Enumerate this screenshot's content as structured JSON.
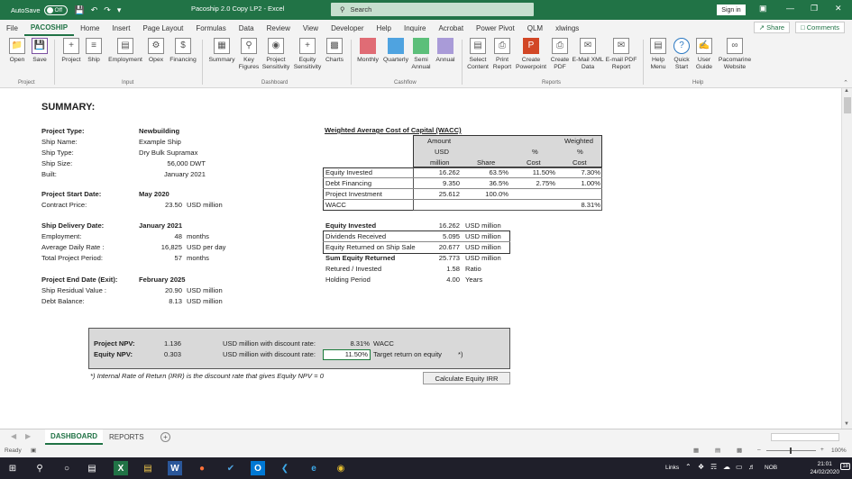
{
  "titlebar": {
    "autosave_label": "AutoSave",
    "autosave_state": "Off",
    "window_title": "Pacoship 2.0 Copy LP2 - Excel",
    "search_placeholder": "Search",
    "signin_label": "Sign in"
  },
  "menu": {
    "tabs": [
      "File",
      "PACOSHIP",
      "Home",
      "Insert",
      "Page Layout",
      "Formulas",
      "Data",
      "Review",
      "View",
      "Developer",
      "Help",
      "Inquire",
      "Acrobat",
      "Power Pivot",
      "QLM",
      "xlwings"
    ],
    "active_tab": "PACOSHIP",
    "share_label": "Share",
    "comments_label": "Comments"
  },
  "ribbon": {
    "buttons": [
      {
        "label": "Open",
        "icon": "folder-icon"
      },
      {
        "label": "Save",
        "icon": "save-icon"
      },
      {
        "label": "Project",
        "icon": "project-icon"
      },
      {
        "label": "Ship",
        "icon": "ship-icon"
      },
      {
        "label": "Employment",
        "icon": "employment-icon"
      },
      {
        "label": "Opex",
        "icon": "opex-icon"
      },
      {
        "label": "Financing",
        "icon": "dollar-icon"
      },
      {
        "label": "Summary",
        "icon": "grid-icon"
      },
      {
        "label": "Key Figures",
        "icon": "magnifier-icon"
      },
      {
        "label": "Project Sensitivity",
        "icon": "sensitivity-icon"
      },
      {
        "label": "Equity Sensitivity",
        "icon": "equity-sensitivity-icon"
      },
      {
        "label": "Charts",
        "icon": "chart-icon"
      },
      {
        "label": "Monthly",
        "icon": "monthly-icon"
      },
      {
        "label": "Quarterly",
        "icon": "quarterly-icon"
      },
      {
        "label": "Semi Annual",
        "icon": "semiannual-icon"
      },
      {
        "label": "Annual",
        "icon": "annual-icon"
      },
      {
        "label": "Select Content",
        "icon": "document-icon"
      },
      {
        "label": "Print Report",
        "icon": "printer-icon"
      },
      {
        "label": "Create Powerpoint",
        "icon": "powerpoint-icon"
      },
      {
        "label": "Create PDF",
        "icon": "pdf-icon"
      },
      {
        "label": "E-Mail XML Data",
        "icon": "email-icon"
      },
      {
        "label": "E-mail PDF Report",
        "icon": "email-pdf-icon"
      },
      {
        "label": "Help Menu",
        "icon": "help-menu-icon"
      },
      {
        "label": "Quick Start",
        "icon": "question-icon"
      },
      {
        "label": "User Guide",
        "icon": "user-guide-icon"
      },
      {
        "label": "Pacomarine Website",
        "icon": "link-icon"
      }
    ],
    "groups": [
      "Project",
      "Input",
      "Dashboard",
      "Cashflow",
      "Reports",
      "Help"
    ]
  },
  "sheet": {
    "title": "SUMMARY:",
    "project": {
      "labels": [
        "Project Type:",
        "Ship Name:",
        "Ship Type:",
        "Ship Size:",
        "Built:"
      ],
      "values": [
        "Newbuilding",
        "Example Ship",
        "Dry Bulk Supramax",
        "56,000 DWT",
        "January 2021"
      ]
    },
    "start": {
      "label_date": "Project Start Date:",
      "value_date": "May 2020",
      "label_price": "Contract Price:",
      "value_price": "23.50",
      "unit_price": "USD million"
    },
    "delivery": {
      "label_date": "Ship Delivery Date:",
      "value_date": "January 2021",
      "label_emp": "Employment:",
      "value_emp": "48",
      "unit_emp": "months",
      "label_rate": "Average Daily Rate :",
      "value_rate": "16,825",
      "unit_rate": "USD per day",
      "label_period": "Total Project Period:",
      "value_period": "57",
      "unit_period": "months"
    },
    "exit": {
      "label_date": "Project End Date (Exit):",
      "value_date": "February 2025",
      "label_residual": "Ship Residual Value :",
      "value_residual": "20.90",
      "label_debt": "Debt Balance:",
      "value_debt": "8.13",
      "unit": "USD million"
    },
    "wacc": {
      "title": "Weighted Average Cost of Capital (WACC)",
      "h_amount": "Amount",
      "h_usd": "USD",
      "h_million": "million",
      "h_share": "Share",
      "h_pct": "%",
      "h_cost": "Cost",
      "h_weighted": "Weighted",
      "rows": [
        {
          "label": "Equity Invested",
          "amount": "16.262",
          "share": "63.5%",
          "cost": "11.50%",
          "weighted": "7.30%"
        },
        {
          "label": "Debt Financing",
          "amount": "9.350",
          "share": "36.5%",
          "cost": "2.75%",
          "weighted": "1.00%"
        },
        {
          "label": "Project Investment",
          "amount": "25.612",
          "share": "100.0%",
          "cost": "",
          "weighted": ""
        },
        {
          "label": "WACC",
          "amount": "",
          "share": "",
          "cost": "",
          "weighted": "8.31%"
        }
      ]
    },
    "equity": {
      "rows": [
        {
          "label": "Equity Invested",
          "value": "16.262",
          "unit": "USD million"
        },
        {
          "label": "Dividends Received",
          "value": "5.095",
          "unit": "USD million"
        },
        {
          "label": "Equity Returned on Ship Sale",
          "value": "20.677",
          "unit": "USD million"
        },
        {
          "label": "Sum Equity Returned",
          "value": "25.773",
          "unit": "USD million"
        },
        {
          "label": "Retured / Invested",
          "value": "1.58",
          "unit": "Ratio"
        },
        {
          "label": "Holding Period",
          "value": "4.00",
          "unit": "Years"
        }
      ]
    },
    "npv": {
      "project_label": "Project NPV:",
      "project_value": "1.136",
      "equity_label": "Equity  NPV:",
      "equity_value": "0.303",
      "discount_label": "USD million with discount rate:",
      "project_rate": "8.31%",
      "project_rate_note": "WACC",
      "equity_rate": "11.50%",
      "equity_rate_note": "Target return on equity",
      "star": "*)"
    },
    "footnote": "*) Internal Rate of Return (IRR) is the discount rate that gives Equity NPV = 0",
    "calc_button": "Calculate Equity IRR"
  },
  "sheet_tabs": [
    "DASHBOARD",
    "REPORTS"
  ],
  "active_sheet": "DASHBOARD",
  "status": {
    "ready": "Ready",
    "zoom": "100%"
  },
  "taskbar": {
    "links_label": "Links",
    "lang": "NOB",
    "time": "21:01",
    "date": "24/02/2020",
    "notif_count": "18"
  },
  "colors": {
    "excel_green": "#217346",
    "panel_gray": "#d9d9d9"
  }
}
